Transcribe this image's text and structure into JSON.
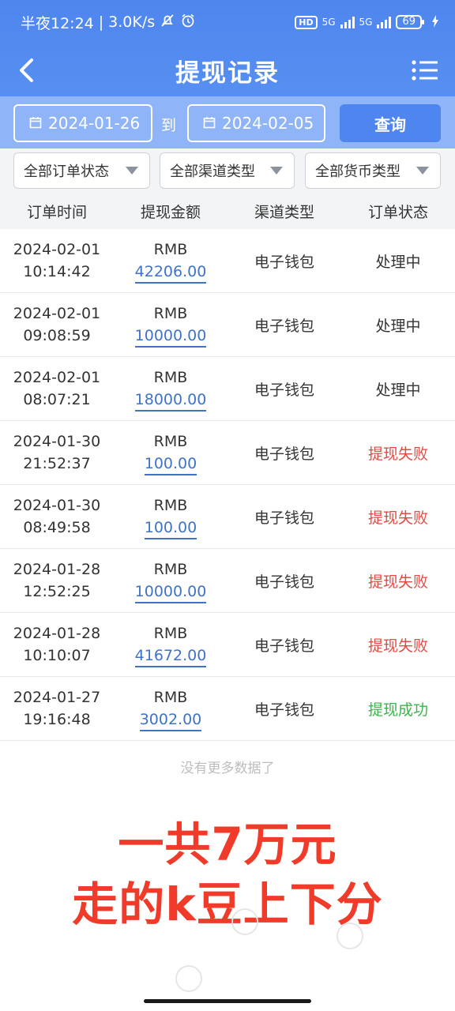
{
  "status_bar": {
    "time": "半夜12:24",
    "speed": "3.0K/s",
    "hd": "HD",
    "net1": "5G",
    "net2": "5G",
    "battery": "69"
  },
  "header": {
    "title": "提现记录"
  },
  "filter": {
    "start_date": "2024-01-26",
    "to_label": "到",
    "end_date": "2024-02-05",
    "query_label": "查询"
  },
  "selects": {
    "order_status": "全部订单状态",
    "channel_type": "全部渠道类型",
    "currency_type": "全部货币类型"
  },
  "table": {
    "headers": [
      "订单时间",
      "提现金额",
      "渠道类型",
      "订单状态"
    ],
    "rows": [
      {
        "date": "2024-02-01",
        "time": "10:14:42",
        "currency": "RMB",
        "amount": "42206.00",
        "channel": "电子钱包",
        "status": "处理中"
      },
      {
        "date": "2024-02-01",
        "time": "09:08:59",
        "currency": "RMB",
        "amount": "10000.00",
        "channel": "电子钱包",
        "status": "处理中"
      },
      {
        "date": "2024-02-01",
        "time": "08:07:21",
        "currency": "RMB",
        "amount": "18000.00",
        "channel": "电子钱包",
        "status": "处理中"
      },
      {
        "date": "2024-01-30",
        "time": "21:52:37",
        "currency": "RMB",
        "amount": "100.00",
        "channel": "电子钱包",
        "status": "提现失败"
      },
      {
        "date": "2024-01-30",
        "time": "08:49:58",
        "currency": "RMB",
        "amount": "100.00",
        "channel": "电子钱包",
        "status": "提现失败"
      },
      {
        "date": "2024-01-28",
        "time": "12:52:25",
        "currency": "RMB",
        "amount": "10000.00",
        "channel": "电子钱包",
        "status": "提现失败"
      },
      {
        "date": "2024-01-28",
        "time": "10:10:07",
        "currency": "RMB",
        "amount": "41672.00",
        "channel": "电子钱包",
        "status": "提现失败"
      },
      {
        "date": "2024-01-27",
        "time": "19:16:48",
        "currency": "RMB",
        "amount": "3002.00",
        "channel": "电子钱包",
        "status": "提现成功"
      }
    ]
  },
  "footer": {
    "no_more": "没有更多数据了"
  },
  "overlay_text": {
    "line1": "一共7万元",
    "line2": "走的k豆上下分"
  },
  "colors": {
    "primary": "#4f86ee",
    "failed": "#e14b44",
    "success": "#3ab54a",
    "link": "#3f73c8",
    "overlay": "#f03a2a"
  }
}
